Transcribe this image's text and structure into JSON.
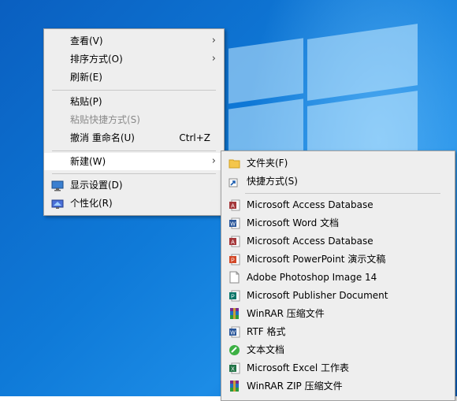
{
  "context_menu": {
    "items": [
      {
        "label": "查看(V)"
      },
      {
        "label": "排序方式(O)"
      },
      {
        "label": "刷新(E)"
      },
      {
        "label": "粘贴(P)"
      },
      {
        "label": "粘贴快捷方式(S)"
      },
      {
        "label": "撤消 重命名(U)",
        "shortcut": "Ctrl+Z"
      },
      {
        "label": "新建(W)"
      },
      {
        "label": "显示设置(D)",
        "icon": "display-settings-icon"
      },
      {
        "label": "个性化(R)",
        "icon": "personalize-icon"
      }
    ]
  },
  "new_submenu": {
    "items": [
      {
        "label": "文件夹(F)",
        "icon": "folder-icon"
      },
      {
        "label": "快捷方式(S)",
        "icon": "shortcut-icon"
      },
      {
        "label": "Microsoft Access Database",
        "icon": "access-icon"
      },
      {
        "label": "Microsoft Word 文档",
        "icon": "word-icon"
      },
      {
        "label": "Microsoft Access Database",
        "icon": "access-icon"
      },
      {
        "label": "Microsoft PowerPoint 演示文稿",
        "icon": "powerpoint-icon"
      },
      {
        "label": "Adobe Photoshop Image 14",
        "icon": "photoshop-file-icon"
      },
      {
        "label": "Microsoft Publisher Document",
        "icon": "publisher-icon"
      },
      {
        "label": "WinRAR 压缩文件",
        "icon": "winrar-icon"
      },
      {
        "label": "RTF 格式",
        "icon": "rtf-icon"
      },
      {
        "label": "文本文档",
        "icon": "text-document-icon"
      },
      {
        "label": "Microsoft Excel 工作表",
        "icon": "excel-icon"
      },
      {
        "label": "WinRAR ZIP 压缩文件",
        "icon": "winrar-zip-icon"
      }
    ]
  },
  "colors": {
    "menu_background": "#eeeeee",
    "desktop_blue": "#0f7ad8",
    "highlight": "#ffffff"
  }
}
